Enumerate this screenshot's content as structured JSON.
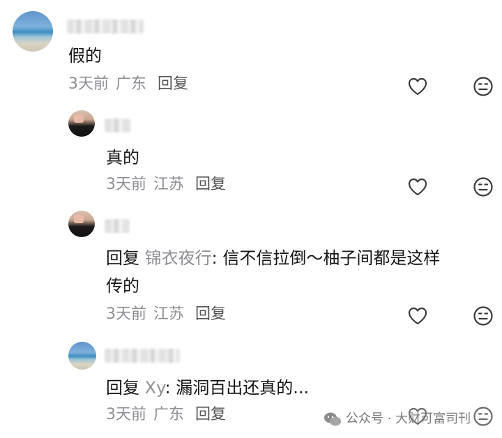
{
  "comments": [
    {
      "text": "假的",
      "time": "3天前",
      "location": "广东",
      "reply": "回复"
    },
    {
      "text": "真的",
      "time": "3天前",
      "location": "江苏",
      "reply": "回复"
    },
    {
      "prefix": "回复",
      "mention": "锦衣夜行",
      "text_line1": ": 信不信拉倒～柚子间都是这样",
      "text_line2": "传的",
      "time": "3天前",
      "location": "江苏",
      "reply": "回复"
    },
    {
      "prefix": "回复",
      "mention": "Xy",
      "text_line1": ": 漏洞百出还真的...",
      "time": "3天前",
      "location": "广东",
      "reply": "回复"
    }
  ],
  "icons": {
    "like": "heart-outline-icon",
    "emoji": "neutral-face-icon"
  },
  "watermark": {
    "text": "公众号 · 大财可富司刊"
  }
}
